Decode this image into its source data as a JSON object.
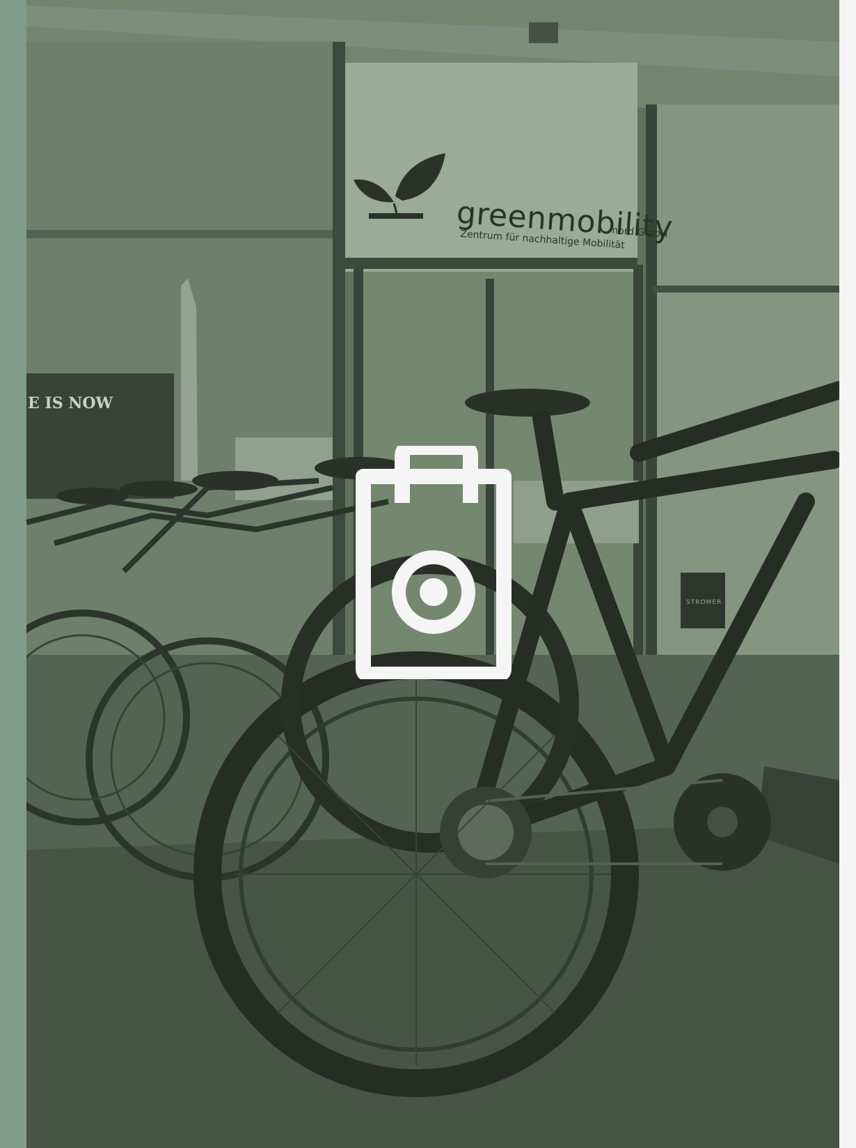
{
  "colors": {
    "accent_strip": "#809c8a",
    "page_background": "#f4f5f4",
    "photo_tint": "#5c6d5b",
    "icon_color": "#f4f5f4"
  },
  "photo": {
    "storefront": {
      "brand_name": "greenmobility",
      "brand_suffix": "nord GmbH",
      "tagline": "Zentrum für nachhaltige Mobilität"
    },
    "left_sign_text": "E IS NOW",
    "back_sign_text": "STROMER"
  },
  "overlay_icon": {
    "name": "shopping-bag-target-icon"
  }
}
